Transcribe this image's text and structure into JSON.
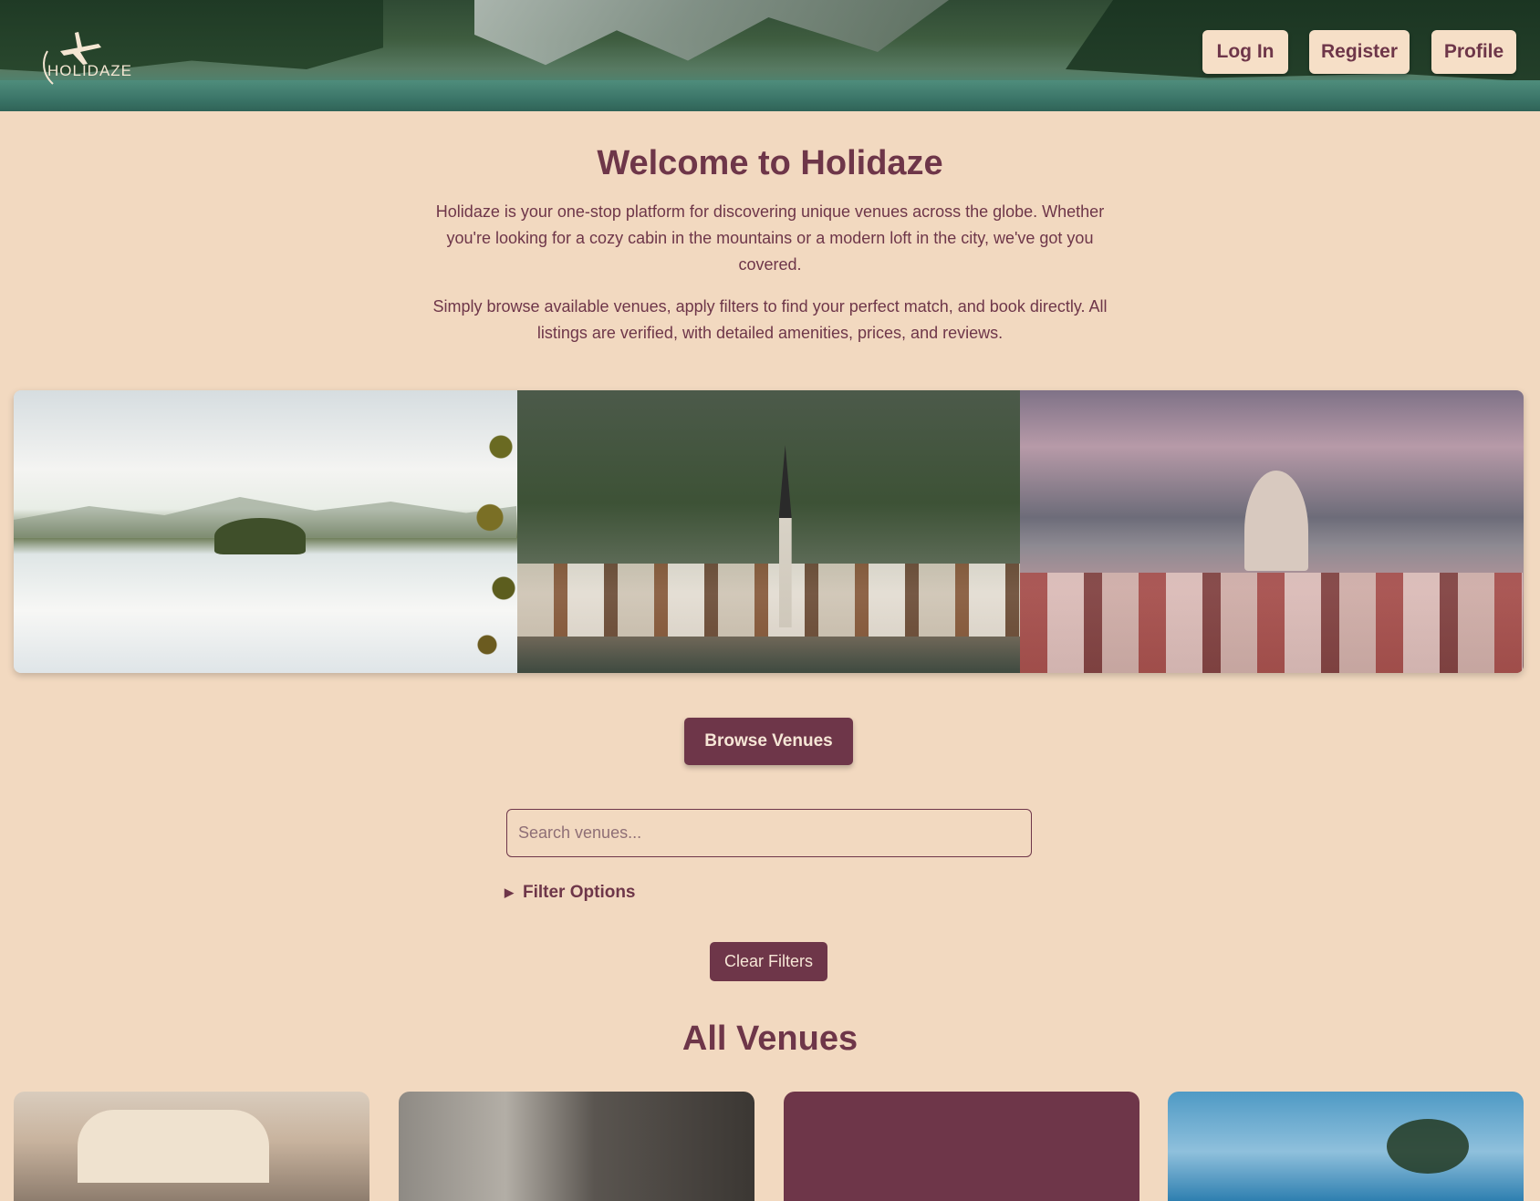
{
  "header": {
    "logo_text": "HOLIDAZE",
    "nav": [
      {
        "label": "Log In"
      },
      {
        "label": "Register"
      },
      {
        "label": "Profile"
      }
    ]
  },
  "intro": {
    "title": "Welcome to Holidaze",
    "paragraph_1": "Holidaze is your one-stop platform for discovering unique venues across the globe. Whether you're looking for a cozy cabin in the mountains or a modern loft in the city, we've got you covered.",
    "paragraph_2": "Simply browse available venues, apply filters to find your perfect match, and book directly. All listings are verified, with detailed amenities, prices, and reviews."
  },
  "gallery": {
    "images": [
      "lake-island-photo",
      "alpine-village-photo",
      "city-dome-photo"
    ]
  },
  "actions": {
    "browse_label": "Browse Venues",
    "search_placeholder": "Search venues...",
    "filter_label": "Filter Options",
    "clear_label": "Clear Filters"
  },
  "venues": {
    "heading": "All Venues",
    "cards": [
      "bedroom-photo",
      "hotel-room-photo",
      "placeholder",
      "beach-palm-photo"
    ]
  },
  "colors": {
    "background": "#F2D9C0",
    "primary": "#6E3649",
    "button_light": "#F6DFC7"
  }
}
